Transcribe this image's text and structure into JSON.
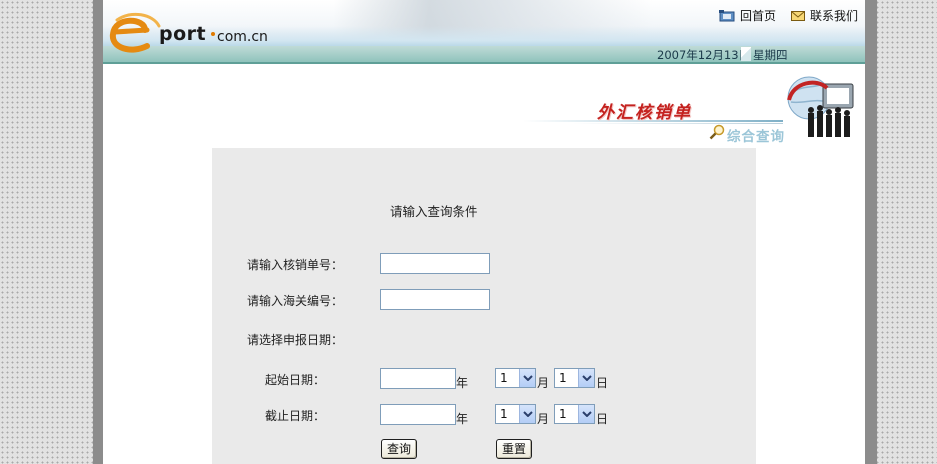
{
  "header": {
    "logo_text": "port",
    "logo_domain": "com.cn",
    "home_link": "回首页",
    "contact_link": "联系我们",
    "date": "2007年12月13日",
    "weekday": "星期四"
  },
  "banner": {
    "title": "外汇核销单",
    "subtitle": "综合查询"
  },
  "form": {
    "prompt": "请输入查询条件",
    "verification_no_label": "请输入核销单号：",
    "verification_no_value": "",
    "customs_no_label": "请输入海关编号：",
    "customs_no_value": "",
    "declare_date_label": "请选择申报日期：",
    "start_date_label": "起始日期：",
    "end_date_label": "截止日期：",
    "year_unit": "年",
    "month_unit": "月",
    "day_unit": "日",
    "start_year_value": "",
    "start_month_value": "1",
    "start_day_value": "1",
    "end_year_value": "",
    "end_month_value": "1",
    "end_day_value": "1",
    "query_button": "查询",
    "reset_button": "重置"
  },
  "colors": {
    "panel_bg": "#eaeaea",
    "banner_title": "#c4221f",
    "date_bar": "#8fc3bc",
    "frame": "#8c8c8c"
  }
}
